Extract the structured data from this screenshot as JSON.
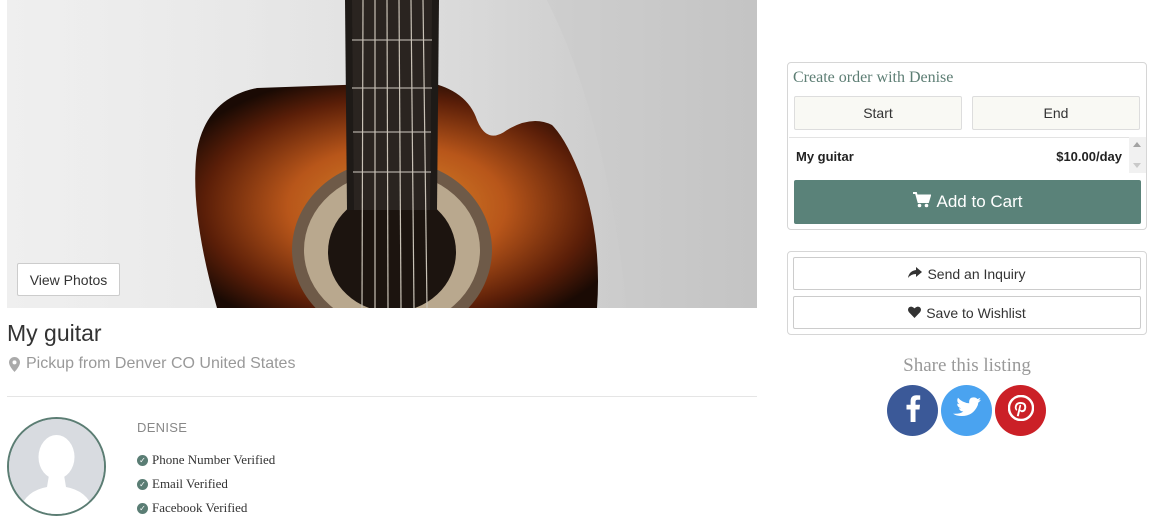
{
  "hero": {
    "view_photos_label": "View Photos"
  },
  "listing": {
    "title": "My guitar",
    "location": "Pickup from Denver CO United States"
  },
  "owner": {
    "name": "DENISE",
    "verifications": [
      "Phone Number Verified",
      "Email Verified",
      "Facebook Verified"
    ]
  },
  "order": {
    "title": "Create order with Denise",
    "start_label": "Start",
    "end_label": "End",
    "item_name": "My guitar",
    "item_price": "$10.00/day",
    "add_to_cart_label": "Add to Cart"
  },
  "actions": {
    "inquiry_label": "Send an Inquiry",
    "wishlist_label": "Save to Wishlist"
  },
  "share": {
    "label": "Share this listing"
  },
  "colors": {
    "accent": "#5a8279",
    "facebook": "#3b5998",
    "twitter": "#4aa3f0",
    "pinterest": "#cb2027"
  },
  "icons": [
    "map-marker-icon",
    "check-circle-icon",
    "cart-icon",
    "share-arrow-icon",
    "heart-icon",
    "facebook-icon",
    "twitter-icon",
    "pinterest-icon"
  ]
}
